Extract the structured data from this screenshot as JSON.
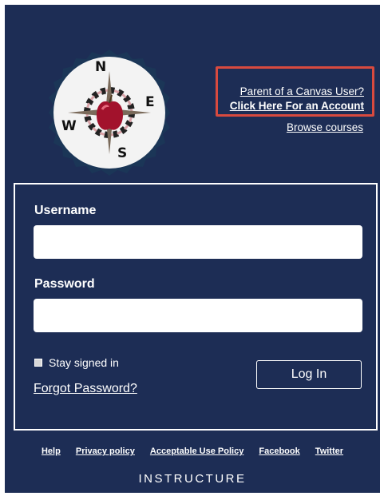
{
  "header": {
    "parent_link": "Parent of a Canvas User?",
    "account_link": "Click Here For an Account",
    "browse_link": "Browse courses"
  },
  "logo": {
    "compass_points": {
      "north": "N",
      "east": "E",
      "south": "S",
      "west": "W"
    },
    "icon": "compass-apple-logo"
  },
  "form": {
    "username_label": "Username",
    "username_value": "",
    "password_label": "Password",
    "password_value": "",
    "stay_signed_in_label": "Stay signed in",
    "stay_signed_in_checked": false,
    "forgot_password": "Forgot Password?",
    "login_button": "Log In"
  },
  "footer": {
    "links": [
      "Help",
      "Privacy policy",
      "Acceptable Use Policy",
      "Facebook",
      "Twitter"
    ],
    "brand": "INSTRUCTURE"
  },
  "colors": {
    "background": "#1d2d55",
    "highlight": "#d84a3f",
    "logo_apple": "#a2122c"
  }
}
